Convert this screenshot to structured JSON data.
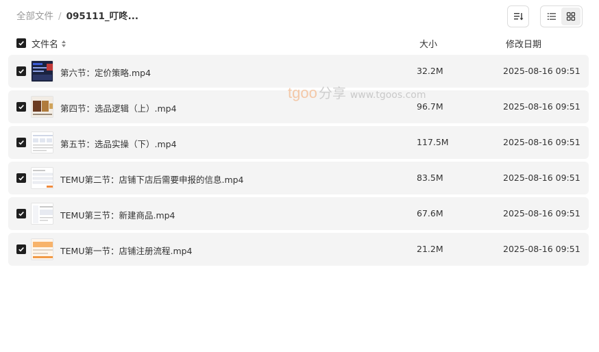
{
  "breadcrumb": {
    "root": "全部文件",
    "separator": "/",
    "current": "095111_叮咚..."
  },
  "toolbar": {
    "sort_icon": "sort-lines-icon",
    "views": [
      {
        "name": "list",
        "icon": "list-view-icon",
        "active": true
      },
      {
        "name": "grid",
        "icon": "grid-view-icon",
        "active": false
      }
    ]
  },
  "header": {
    "select_all_checked": true,
    "name_label": "文件名",
    "size_label": "大小",
    "date_label": "修改日期"
  },
  "files": [
    {
      "name": "第六节：定价策略.mp4",
      "size": "32.2M",
      "modified": "2025-08-16 09:51",
      "checked": true,
      "thumb": "dark"
    },
    {
      "name": "第四节：选品逻辑（上）.mp4",
      "size": "96.7M",
      "modified": "2025-08-16 09:51",
      "checked": true,
      "thumb": "photo"
    },
    {
      "name": "第五节：选品实操（下）.mp4",
      "size": "117.5M",
      "modified": "2025-08-16 09:51",
      "checked": true,
      "thumb": "table"
    },
    {
      "name": "TEMU第二节：店铺下店后需要申报的信息.mp4",
      "size": "83.5M",
      "modified": "2025-08-16 09:51",
      "checked": true,
      "thumb": "form"
    },
    {
      "name": "TEMU第三节：新建商品.mp4",
      "size": "67.6M",
      "modified": "2025-08-16 09:51",
      "checked": true,
      "thumb": "page"
    },
    {
      "name": "TEMU第一节：店铺注册流程.mp4",
      "size": "21.2M",
      "modified": "2025-08-16 09:51",
      "checked": true,
      "thumb": "orange"
    }
  ],
  "watermark": {
    "brand": "tgoo",
    "cn": "分享",
    "url": "www.tgoos.com"
  },
  "colors": {
    "row_bg": "#f4f4f4",
    "checkbox": "#1f1f1f",
    "watermark_brand": "#f3c8a8"
  }
}
